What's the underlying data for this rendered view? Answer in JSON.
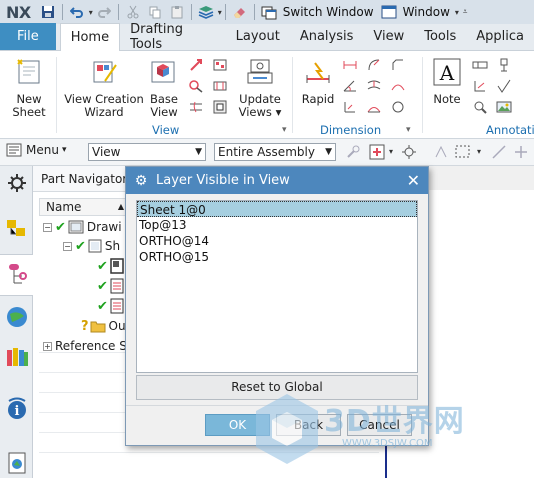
{
  "app": {
    "logo": "NX",
    "switch_window": "Switch Window",
    "window_menu": "Window"
  },
  "tabs": [
    {
      "label": "File"
    },
    {
      "label": "Home",
      "active": true
    },
    {
      "label": "Drafting Tools"
    },
    {
      "label": "Layout"
    },
    {
      "label": "Analysis"
    },
    {
      "label": "View"
    },
    {
      "label": "Tools"
    },
    {
      "label": "Applica"
    }
  ],
  "ribbon": {
    "new_sheet_1": "New",
    "new_sheet_2": "Sheet",
    "view_creation_wizard_1": "View Creation",
    "view_creation_wizard_2": "Wizard",
    "base_view_1": "Base",
    "base_view_2": "View",
    "update_views_1": "Update",
    "update_views_2": "Views",
    "rapid": "Rapid",
    "note": "Note",
    "group_view": "View",
    "group_dimension": "Dimension",
    "group_annotation": "Annotatio"
  },
  "selection_bar": {
    "menu": "Menu",
    "filter_value": "View",
    "scope_value": "Entire Assembly"
  },
  "navigator": {
    "title": "Part Navigator",
    "col_name": "Name",
    "rows": [
      {
        "label": "Drawi"
      },
      {
        "label": "Sh"
      },
      {
        "label": ""
      },
      {
        "label": ""
      },
      {
        "label": ""
      },
      {
        "label": "Ou"
      },
      {
        "label": "Reference Se"
      }
    ]
  },
  "dialog": {
    "title": "Layer Visible in View",
    "items": [
      "Sheet 1@0",
      "Top@13",
      "ORTHO@14",
      "ORTHO@15"
    ],
    "selected_index": 0,
    "reset_button": "Reset to Global",
    "ok_button": "OK",
    "back_button": "Back",
    "cancel_button": "Cancel"
  },
  "watermark": {
    "text": "3D世界网",
    "url": "WWW.3DSJW.COM"
  },
  "colors": {
    "accent": "#4d87bd",
    "file_tab": "#3e8ec2",
    "selection": "#a6cfe0",
    "check": "#1fa21f",
    "group_label": "#1c6fb0"
  }
}
